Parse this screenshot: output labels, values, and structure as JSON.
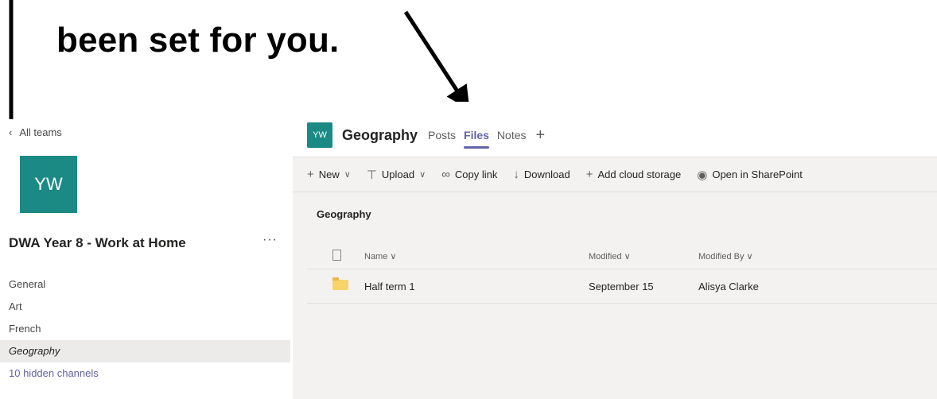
{
  "annotation": {
    "text": "been set for you."
  },
  "sidebar": {
    "back_label": "All teams",
    "team_initials": "YW",
    "team_name": "DWA Year 8 - Work at Home",
    "more_label": "···",
    "channels": [
      {
        "label": "General"
      },
      {
        "label": "Art"
      },
      {
        "label": "French"
      },
      {
        "label": "Geography"
      }
    ],
    "hidden_channels_label": "10 hidden channels"
  },
  "channel_header": {
    "initials": "YW",
    "title": "Geography",
    "tabs": [
      {
        "label": "Posts"
      },
      {
        "label": "Files"
      },
      {
        "label": "Notes"
      }
    ],
    "add_tab_label": "+"
  },
  "toolbar": {
    "new_label": "New",
    "upload_label": "Upload",
    "copy_link_label": "Copy link",
    "download_label": "Download",
    "add_cloud_label": "Add cloud storage",
    "open_sharepoint_label": "Open in SharePoint"
  },
  "files": {
    "breadcrumb": "Geography",
    "columns": {
      "name": "Name",
      "modified": "Modified",
      "modified_by": "Modified By"
    },
    "rows": [
      {
        "name": "Half term 1",
        "modified": "September 15",
        "modified_by": "Alisya Clarke"
      }
    ]
  },
  "colors": {
    "accent": "#6264a7",
    "team_tile": "#1b8a85",
    "folder": "#f8d26a"
  }
}
